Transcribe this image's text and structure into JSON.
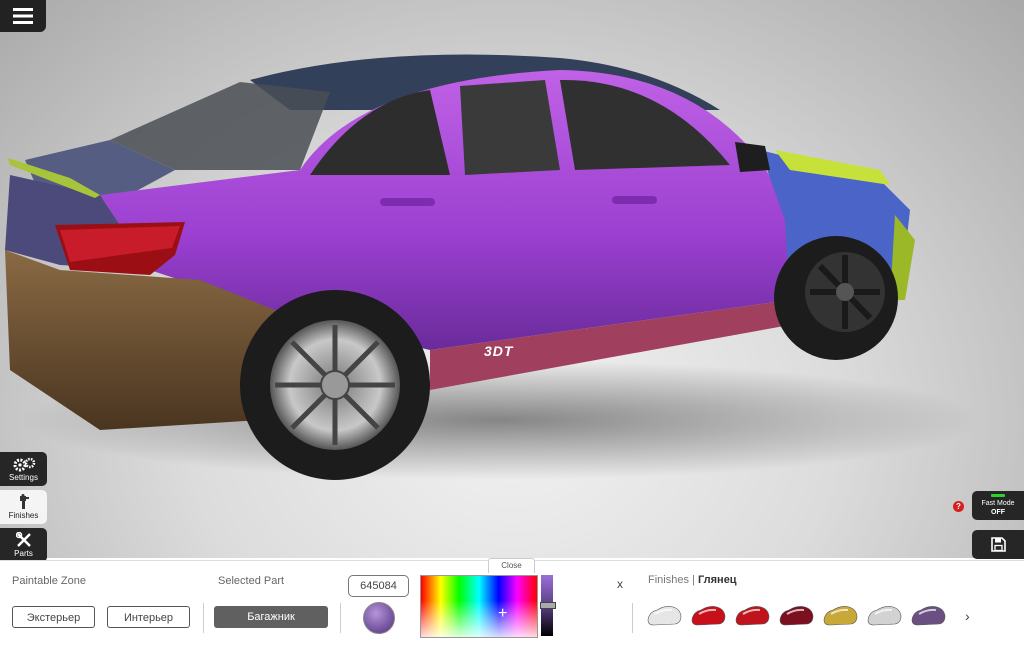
{
  "viewport": {
    "watermark": "3DT",
    "menu_icon": "hamburger-icon"
  },
  "sidebar": {
    "items": [
      {
        "label": "Settings",
        "icon": "gears-icon"
      },
      {
        "label": "Finishes",
        "icon": "spray-gun-icon"
      },
      {
        "label": "Parts",
        "icon": "tools-icon"
      }
    ]
  },
  "fast_mode": {
    "help": "?",
    "title": "Fast Mode",
    "state": "OFF",
    "indicator_color": "#2bd42b"
  },
  "save": {
    "icon": "floppy-disk-icon"
  },
  "panel": {
    "close_label": "Close",
    "paintable_zone": {
      "label": "Paintable Zone",
      "options": [
        "Экстерьер",
        "Интерьер"
      ]
    },
    "selected_part": {
      "label": "Selected Part",
      "value": "Багажник"
    },
    "color": {
      "hex": "645084",
      "swatch_color": "#7d5aa8"
    },
    "close_x": "x",
    "finishes": {
      "label": "Finishes",
      "selected": "Глянец",
      "items": [
        {
          "name": "white",
          "color": "#e6e6e6"
        },
        {
          "name": "red",
          "color": "#c8101a"
        },
        {
          "name": "red-gloss",
          "color": "#c0141c"
        },
        {
          "name": "maroon",
          "color": "#7a1020"
        },
        {
          "name": "gold",
          "color": "#c9a83a"
        },
        {
          "name": "silver",
          "color": "#d2d2d2"
        },
        {
          "name": "purple-metallic",
          "color": "#6a5080"
        }
      ],
      "next_icon": "chevron-right-icon"
    }
  }
}
